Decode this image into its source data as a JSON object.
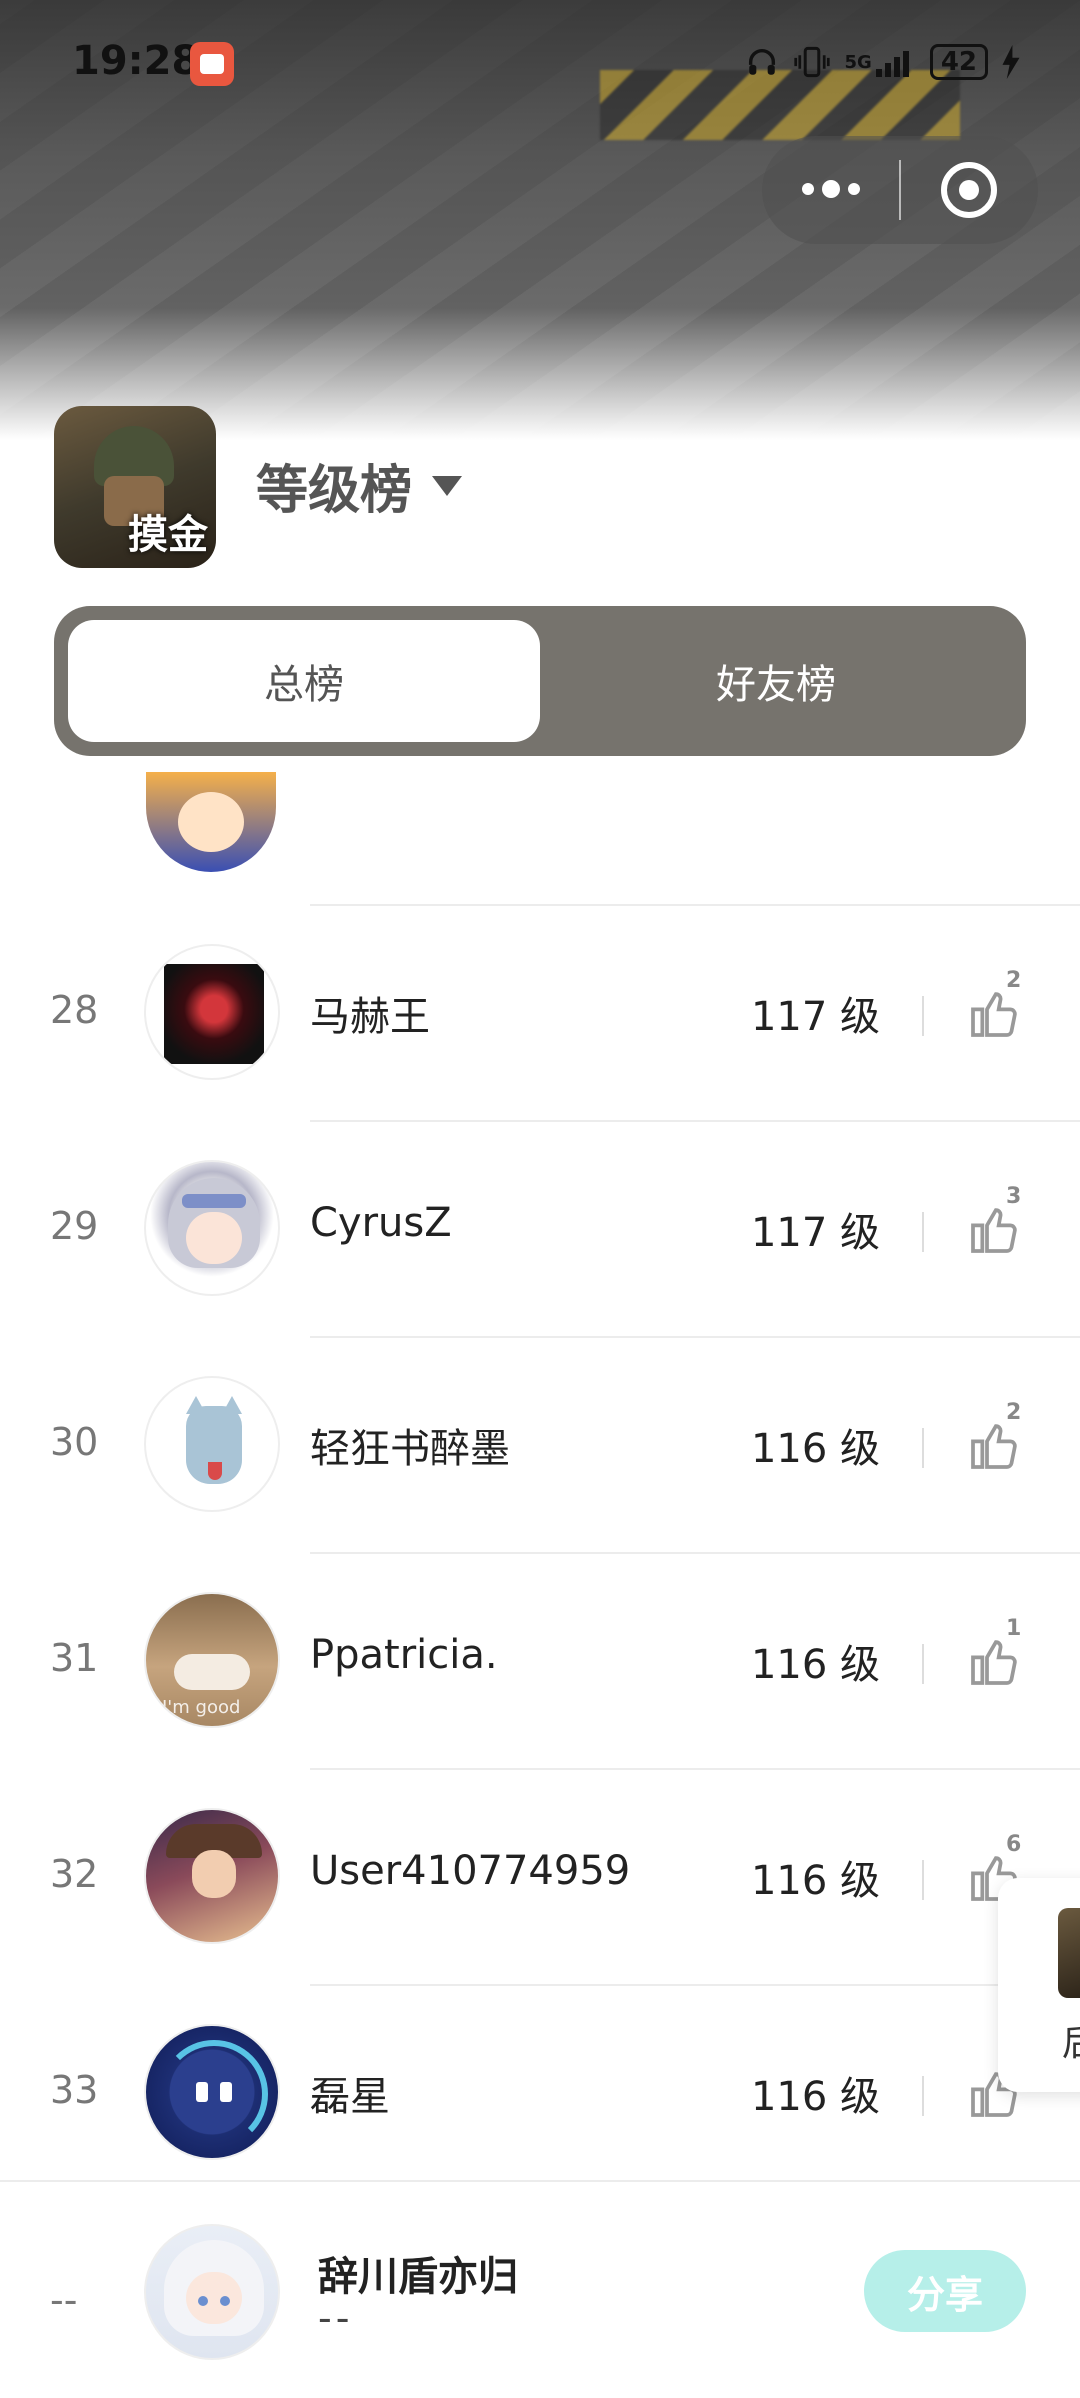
{
  "status_bar": {
    "time": "19:28",
    "network": "5G",
    "battery": "42",
    "charging": true
  },
  "header": {
    "game_icon_text": "摸金",
    "board_title": "等级榜"
  },
  "tabs": [
    {
      "label": "总榜",
      "active": true
    },
    {
      "label": "好友榜",
      "active": false
    }
  ],
  "rankings": [
    {
      "rank": "28",
      "name": "马赫王",
      "level": "117 级",
      "likes": "2",
      "avatar": "red-dragon-avatar"
    },
    {
      "rank": "29",
      "name": "CyrusZ",
      "level": "117 级",
      "likes": "3",
      "avatar": "anime-girl-avatar"
    },
    {
      "rank": "30",
      "name": "轻狂书醉墨",
      "level": "116 级",
      "likes": "2",
      "avatar": "cat-cartoon-avatar"
    },
    {
      "rank": "31",
      "name": "Ppatricia.",
      "level": "116 级",
      "likes": "1",
      "avatar": "sleeping-cat-photo-avatar",
      "avatar_caption": "I'm good"
    },
    {
      "rank": "32",
      "name": "User410774959",
      "level": "116 级",
      "likes": "6",
      "avatar": "warrior-woman-avatar"
    },
    {
      "rank": "33",
      "name": "磊星",
      "level": "116 级",
      "likes": "",
      "avatar": "robot-avatar"
    }
  ],
  "floating_widget": {
    "text": "后"
  },
  "my_rank": {
    "rank": "--",
    "name": "辞川盾亦归",
    "level": "--",
    "share_label": "分享"
  },
  "colors": {
    "tab_bg": "#76736d",
    "share_button": "#b6efe9"
  }
}
